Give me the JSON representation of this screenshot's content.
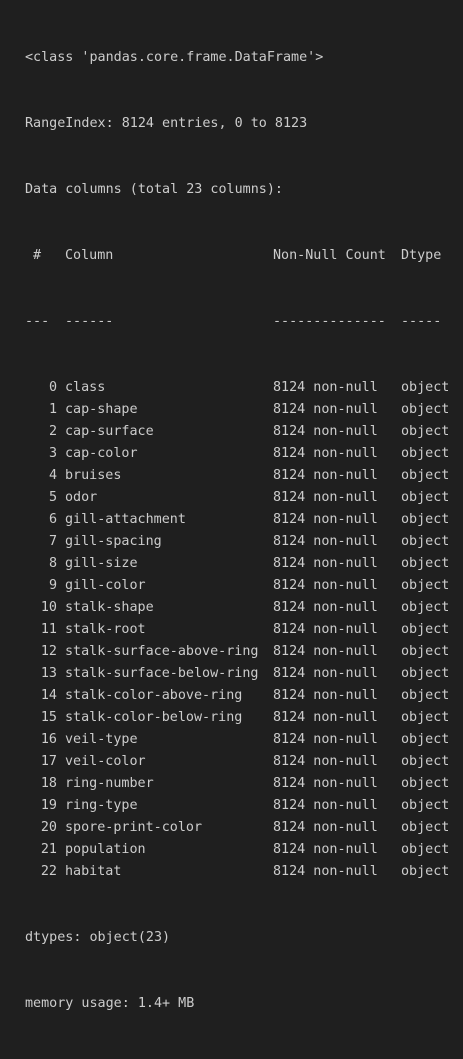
{
  "output": {
    "class_line": "<class 'pandas.core.frame.DataFrame'>",
    "range_index": "RangeIndex: 8124 entries, 0 to 8123",
    "data_columns": "Data columns (total 23 columns):",
    "header": {
      "num": "#",
      "column": "Column",
      "count": "Non-Null Count",
      "dtype": "Dtype"
    },
    "separator": {
      "num": "---",
      "column": "------",
      "count": "--------------",
      "dtype": "-----"
    },
    "rows": [
      {
        "num": "0",
        "column": "class",
        "count": "8124 non-null",
        "dtype": "object"
      },
      {
        "num": "1",
        "column": "cap-shape",
        "count": "8124 non-null",
        "dtype": "object"
      },
      {
        "num": "2",
        "column": "cap-surface",
        "count": "8124 non-null",
        "dtype": "object"
      },
      {
        "num": "3",
        "column": "cap-color",
        "count": "8124 non-null",
        "dtype": "object"
      },
      {
        "num": "4",
        "column": "bruises",
        "count": "8124 non-null",
        "dtype": "object"
      },
      {
        "num": "5",
        "column": "odor",
        "count": "8124 non-null",
        "dtype": "object"
      },
      {
        "num": "6",
        "column": "gill-attachment",
        "count": "8124 non-null",
        "dtype": "object"
      },
      {
        "num": "7",
        "column": "gill-spacing",
        "count": "8124 non-null",
        "dtype": "object"
      },
      {
        "num": "8",
        "column": "gill-size",
        "count": "8124 non-null",
        "dtype": "object"
      },
      {
        "num": "9",
        "column": "gill-color",
        "count": "8124 non-null",
        "dtype": "object"
      },
      {
        "num": "10",
        "column": "stalk-shape",
        "count": "8124 non-null",
        "dtype": "object"
      },
      {
        "num": "11",
        "column": "stalk-root",
        "count": "8124 non-null",
        "dtype": "object"
      },
      {
        "num": "12",
        "column": "stalk-surface-above-ring",
        "count": "8124 non-null",
        "dtype": "object"
      },
      {
        "num": "13",
        "column": "stalk-surface-below-ring",
        "count": "8124 non-null",
        "dtype": "object"
      },
      {
        "num": "14",
        "column": "stalk-color-above-ring",
        "count": "8124 non-null",
        "dtype": "object"
      },
      {
        "num": "15",
        "column": "stalk-color-below-ring",
        "count": "8124 non-null",
        "dtype": "object"
      },
      {
        "num": "16",
        "column": "veil-type",
        "count": "8124 non-null",
        "dtype": "object"
      },
      {
        "num": "17",
        "column": "veil-color",
        "count": "8124 non-null",
        "dtype": "object"
      },
      {
        "num": "18",
        "column": "ring-number",
        "count": "8124 non-null",
        "dtype": "object"
      },
      {
        "num": "19",
        "column": "ring-type",
        "count": "8124 non-null",
        "dtype": "object"
      },
      {
        "num": "20",
        "column": "spore-print-color",
        "count": "8124 non-null",
        "dtype": "object"
      },
      {
        "num": "21",
        "column": "population",
        "count": "8124 non-null",
        "dtype": "object"
      },
      {
        "num": "22",
        "column": "habitat",
        "count": "8124 non-null",
        "dtype": "object"
      }
    ],
    "dtypes_line": "dtypes: object(23)",
    "memory_line": "memory usage: 1.4+ MB"
  },
  "colors": {
    "background": "#1f1f1f",
    "text": "#cccccc"
  }
}
